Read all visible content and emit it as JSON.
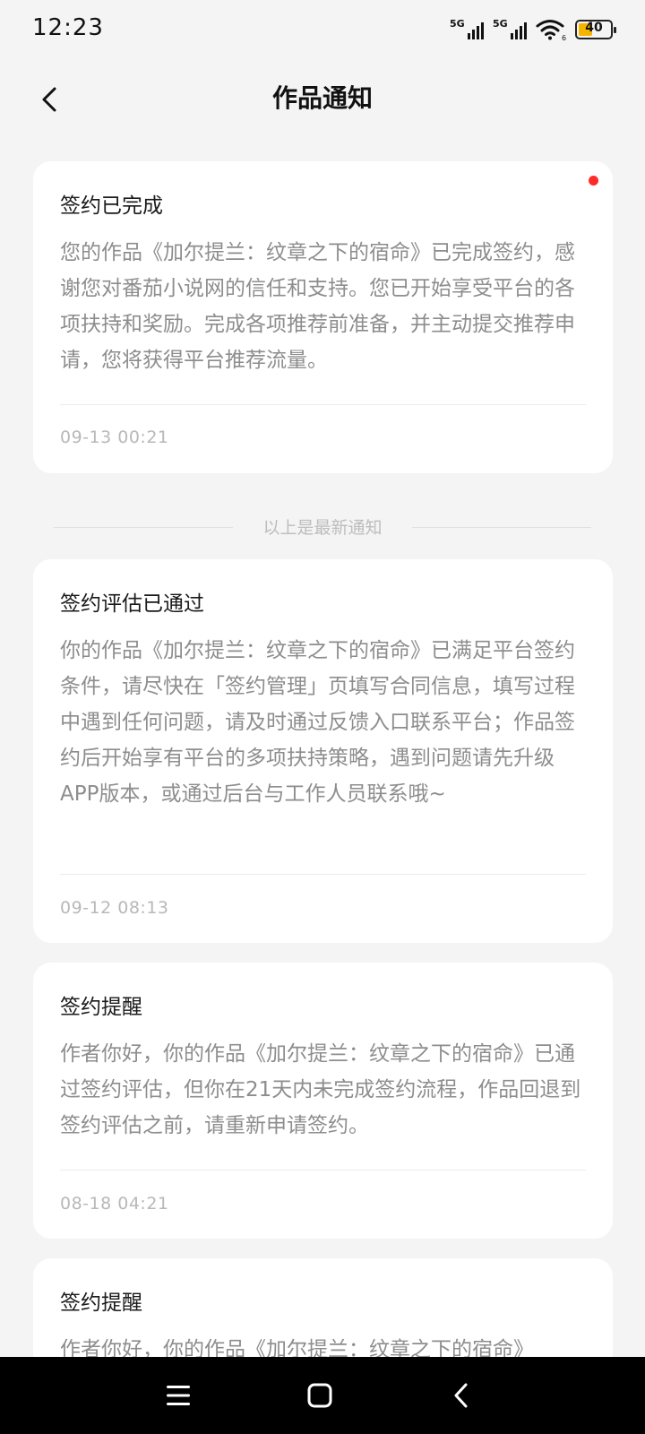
{
  "status_bar": {
    "time": "12:23",
    "network1": "5G",
    "network2": "5G",
    "wifi_badge": "6",
    "battery": "40"
  },
  "header": {
    "title": "作品通知",
    "back_icon": "chevron-left-icon"
  },
  "latest_divider": "以上是最新通知",
  "notifications": [
    {
      "title": "签约已完成",
      "body": "您的作品《加尔提兰：纹章之下的宿命》已完成签约，感谢您对番茄小说网的信任和支持。您已开始享受平台的各项扶持和奖励。完成各项推荐前准备，并主动提交推荐申请，您将获得平台推荐流量。",
      "time": "09-13 00:21",
      "unread": true
    },
    {
      "title": "签约评估已通过",
      "body": "你的作品《加尔提兰：纹章之下的宿命》已满足平台签约条件，请尽快在「签约管理」页填写合同信息，填写过程中遇到任何问题，请及时通过反馈入口联系平台；作品签约后开始享有平台的多项扶持策略，遇到问题请先升级APP版本，或通过后台与工作人员联系哦~",
      "time": "09-12 08:13",
      "unread": false
    },
    {
      "title": "签约提醒",
      "body": "作者你好，你的作品《加尔提兰：纹章之下的宿命》已通过签约评估，但你在21天内未完成签约流程，作品回退到签约评估之前，请重新申请签约。",
      "time": "08-18 04:21",
      "unread": false
    },
    {
      "title": "签约提醒",
      "body": "作者你好，你的作品《加尔提兰：纹章之下的宿命》",
      "time": "",
      "unread": false
    }
  ],
  "nav_bar": {
    "menu_icon": "menu-icon",
    "home_icon": "home-square-icon",
    "back_icon": "back-triangle-icon"
  },
  "colors": {
    "background": "#f4f4f4",
    "card": "#ffffff",
    "unread_dot": "#ff2a2a",
    "battery_fill": "#f4b400"
  }
}
